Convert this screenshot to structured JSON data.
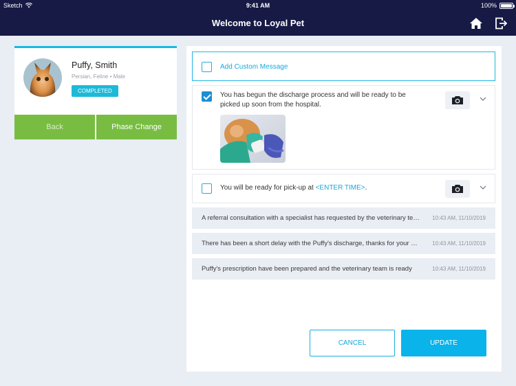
{
  "status_bar": {
    "carrier": "Sketch",
    "time": "9:41 AM",
    "battery": "100%"
  },
  "header": {
    "title": "Welcome to Loyal Pet",
    "icons": [
      "home-icon",
      "logout-icon"
    ]
  },
  "patient": {
    "name": "Puffy, Smith",
    "breed_info": "Persian, Feline • Male",
    "status": "COMPLETED",
    "back_label": "Back",
    "phase_change_label": "Phase Change"
  },
  "messages": {
    "custom_label": "Add Custom Message",
    "discharge": {
      "checked": true,
      "text": "You has begun the discharge process and will be ready to be picked up soon from the hospital."
    },
    "pickup": {
      "checked": false,
      "text_before": "You will be ready for pick-up at ",
      "placeholder": "<ENTER TIME>",
      "text_after": "."
    },
    "history": [
      {
        "text": "A referral consultation with a specialist has requested by the veterinary team",
        "time": "10:43 AM, 11/10/2019"
      },
      {
        "text": "There has been a short delay with the Puffy's discharge, thanks for your patience",
        "time": "10:43 AM, 11/10/2019"
      },
      {
        "text": "Puffy's prescription have been prepared and the veterinary team is ready",
        "time": "10:43 AM, 11/10/2019"
      }
    ]
  },
  "actions": {
    "cancel_label": "CANCEL",
    "update_label": "UPDATE"
  },
  "colors": {
    "navbar": "#171a45",
    "accent": "#16b8e3",
    "green": "#78bd42",
    "primary_button": "#0ab3ea"
  }
}
